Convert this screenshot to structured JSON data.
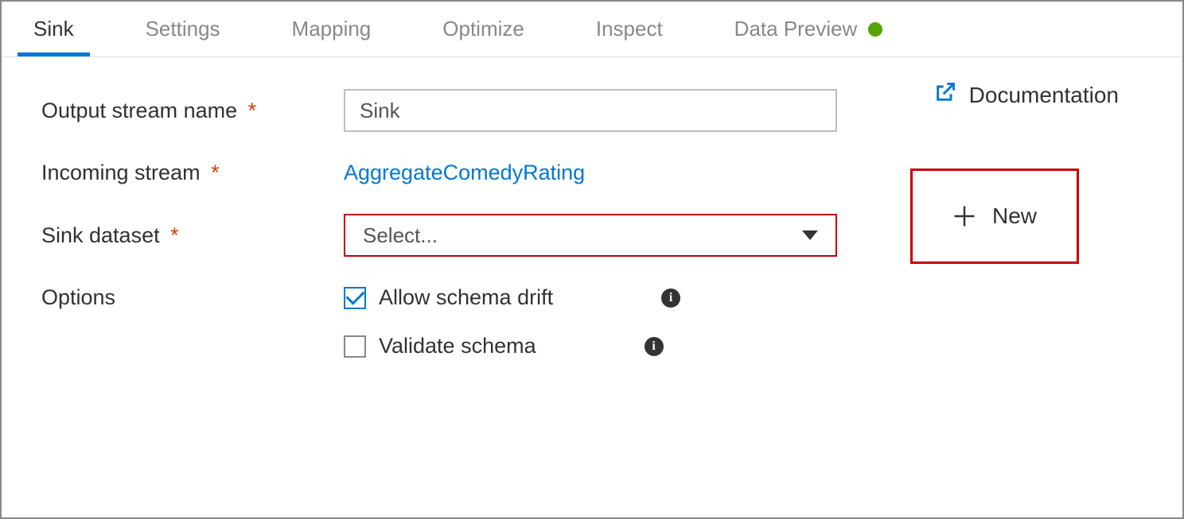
{
  "tabs": {
    "sink": "Sink",
    "settings": "Settings",
    "mapping": "Mapping",
    "optimize": "Optimize",
    "inspect": "Inspect",
    "data_preview": "Data Preview"
  },
  "form": {
    "output_stream_name": {
      "label": "Output stream name",
      "value": "Sink"
    },
    "incoming_stream": {
      "label": "Incoming stream",
      "value": "AggregateComedyRating"
    },
    "sink_dataset": {
      "label": "Sink dataset",
      "placeholder": "Select..."
    },
    "options": {
      "label": "Options",
      "allow_schema_drift": {
        "label": "Allow schema drift",
        "checked": true
      },
      "validate_schema": {
        "label": "Validate schema",
        "checked": false
      }
    }
  },
  "buttons": {
    "new": "New",
    "documentation": "Documentation"
  }
}
